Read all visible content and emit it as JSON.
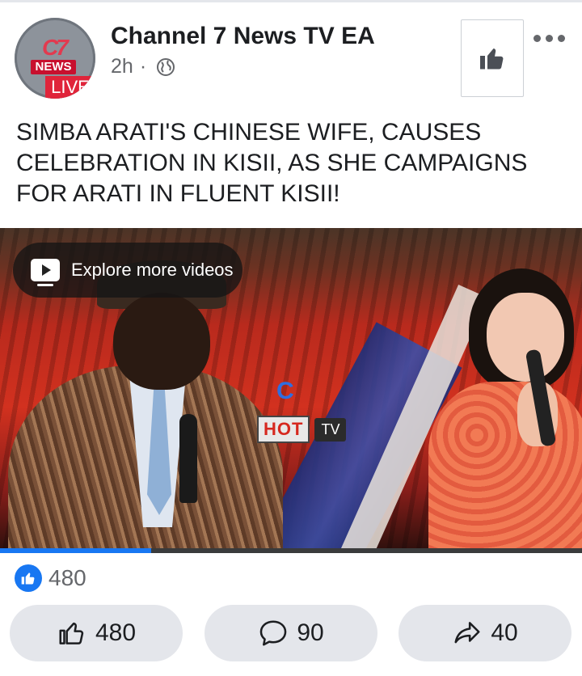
{
  "post": {
    "page_name": "Channel 7 News TV EA",
    "time": "2h",
    "separator": "·",
    "privacy_icon": "globe-icon",
    "avatar": {
      "logo_text": "C7",
      "news_label": "NEWS",
      "live_label": "LIVE"
    },
    "text": "SIMBA ARATI'S CHINESE WIFE, CAUSES CELEBRATION IN KISII, AS SHE CAMPAIGNS FOR ARATI IN FLUENT KISII!"
  },
  "header_actions": {
    "like_page_icon": "thumbs-up-icon",
    "more_icon": "more-dots-icon"
  },
  "video": {
    "explore_label": "Explore more videos",
    "watermark_hot": "HOT",
    "watermark_tv": "TV",
    "loading_glyph": "C",
    "progress_fraction": 0.26
  },
  "reactions": {
    "count": "480",
    "icon": "like-badge-icon"
  },
  "actions": {
    "like": {
      "count": "480",
      "icon": "thumbs-up-icon"
    },
    "comment": {
      "count": "90",
      "icon": "comment-icon"
    },
    "share": {
      "count": "40",
      "icon": "share-icon"
    }
  },
  "colors": {
    "accent": "#1877f2",
    "button_bg": "#e4e6eb",
    "text_secondary": "#65676b"
  }
}
